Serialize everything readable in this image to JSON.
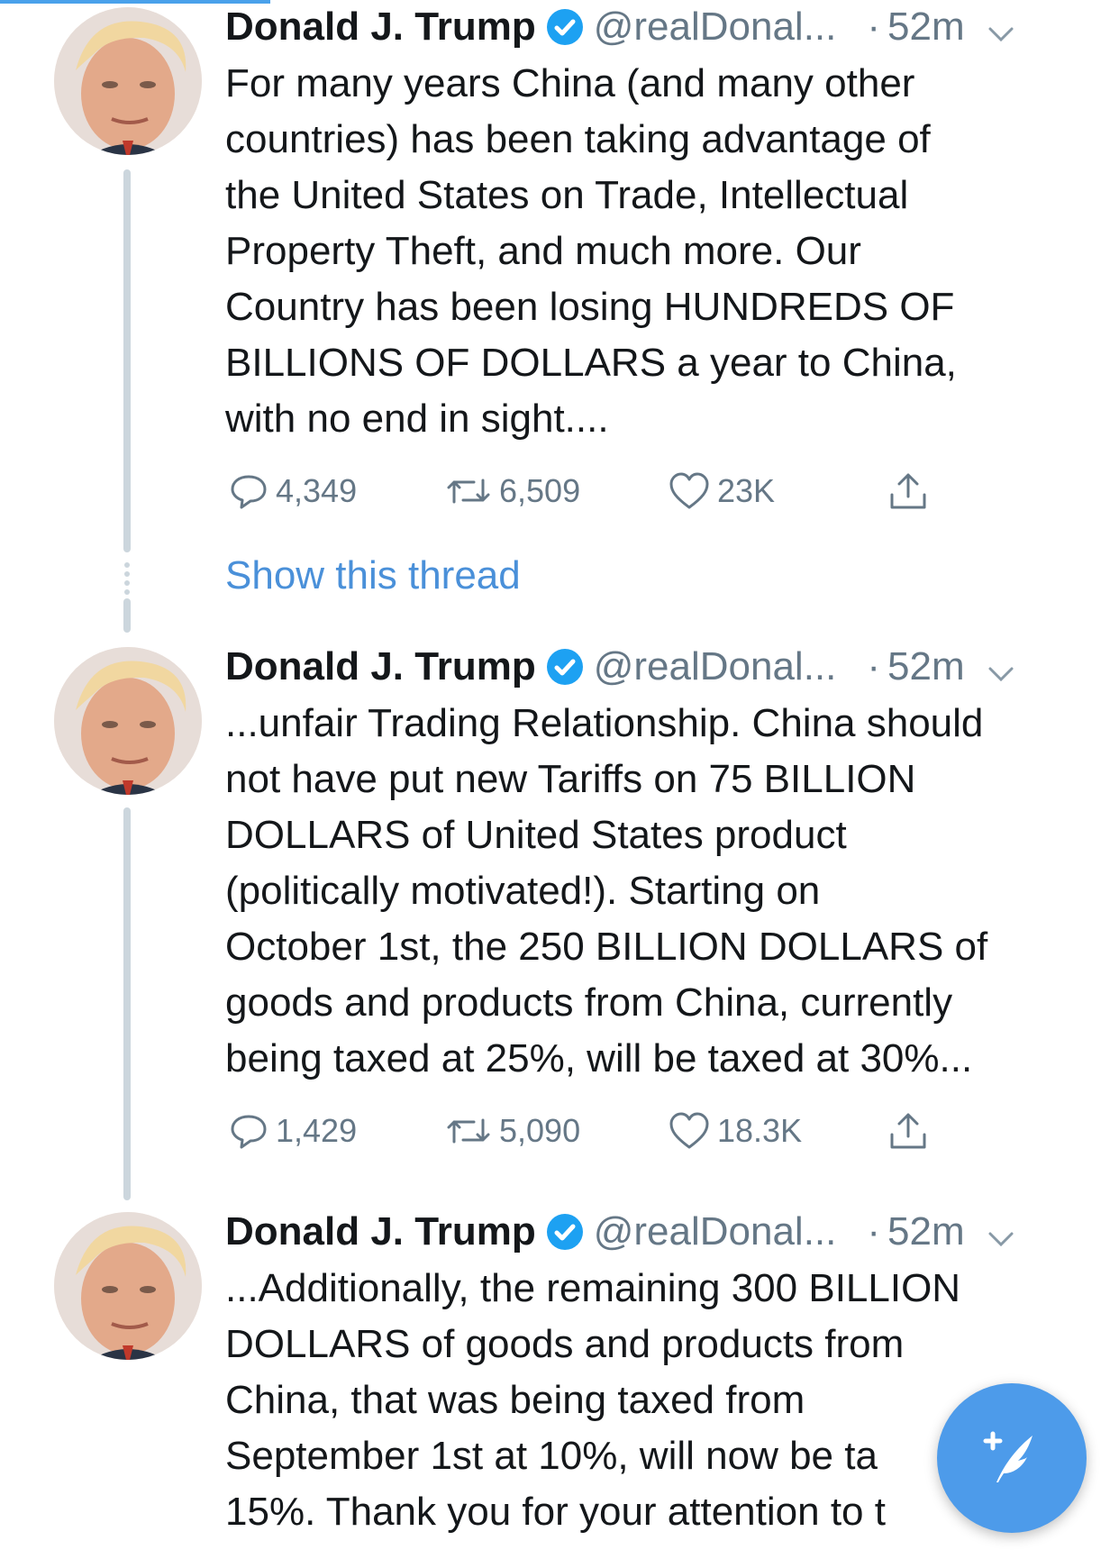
{
  "colors": {
    "accent": "#4a90d9",
    "verified": "#1da1f2",
    "muted": "#657786",
    "thread_line": "#ccd6dd",
    "fab": "#4d9bea"
  },
  "tweets": [
    {
      "name": "Donald J. Trump",
      "handle": "@realDonal...",
      "separator": "·",
      "time": "52m",
      "text": "For many years China (and many other\ncountries) has been taking advantage of\nthe United States on Trade, Intellectual\nProperty Theft, and much more. Our\nCountry has been losing HUNDREDS OF\nBILLIONS OF DOLLARS a year to China,\nwith no end in sight....",
      "replies": "4,349",
      "retweets": "6,509",
      "likes": "23K"
    },
    {
      "name": "Donald J. Trump",
      "handle": "@realDonal...",
      "separator": "·",
      "time": "52m",
      "text": "...unfair Trading Relationship. China should\nnot have put new Tariffs on 75 BILLION\nDOLLARS of United States product\n(politically motivated!). Starting on\nOctober 1st, the 250 BILLION DOLLARS of\ngoods and products from China, currently\nbeing taxed at 25%, will be taxed at 30%...",
      "replies": "1,429",
      "retweets": "5,090",
      "likes": "18.3K"
    },
    {
      "name": "Donald J. Trump",
      "handle": "@realDonal...",
      "separator": "·",
      "time": "52m",
      "text": "...Additionally, the remaining 300 BILLION\nDOLLARS of goods and products from\nChina, that was being taxed from\nSeptember 1st at 10%, will now be ta\n15%. Thank you for your attention to t"
    }
  ],
  "show_thread_label": "Show this thread",
  "icons": {
    "reply": "reply-icon",
    "retweet": "retweet-icon",
    "like": "heart-icon",
    "share": "share-icon",
    "verified": "verified-badge-icon",
    "caret": "chevron-down-icon",
    "compose": "compose-tweet-icon"
  }
}
